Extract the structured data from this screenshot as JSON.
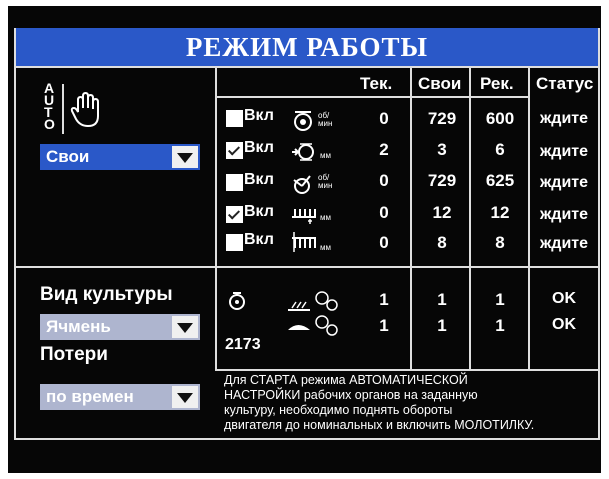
{
  "title": "РЕЖИМ РАБОТЫ",
  "mode": {
    "auto_label": "AUTO",
    "selected": "Свои"
  },
  "table": {
    "headers": [
      "Тек.",
      "Свои",
      "Рек.",
      "Статус"
    ],
    "rows": [
      {
        "toggle": "Вкл",
        "checked": false,
        "unit": "об/мин",
        "icon": "rotor-speed-icon",
        "tek": "0",
        "svoi": "729",
        "rek": "600",
        "status": "ждите"
      },
      {
        "toggle": "Вкл",
        "checked": true,
        "unit": "мм",
        "icon": "concave-gap-icon",
        "tek": "2",
        "svoi": "3",
        "rek": "6",
        "status": "ждите"
      },
      {
        "toggle": "Вкл",
        "checked": false,
        "unit": "об/мин",
        "icon": "fan-speed-icon",
        "tek": "0",
        "svoi": "729",
        "rek": "625",
        "status": "ждите"
      },
      {
        "toggle": "Вкл",
        "checked": true,
        "unit": "мм",
        "icon": "upper-sieve-icon",
        "tek": "0",
        "svoi": "12",
        "rek": "12",
        "status": "ждите"
      },
      {
        "toggle": "Вкл",
        "checked": false,
        "unit": "мм",
        "icon": "lower-sieve-icon",
        "tek": "0",
        "svoi": "8",
        "rek": "8",
        "status": "ждите"
      }
    ]
  },
  "crop": {
    "label": "Вид культуры",
    "selected": "Ячмень"
  },
  "losses": {
    "label": "Потери",
    "selected": "по времен"
  },
  "loss_sensors": {
    "code": "2173",
    "rows": [
      {
        "icon": "straw-walker-loss-icon",
        "tek": "1",
        "svoi": "1",
        "rek": "1",
        "status": "OK"
      },
      {
        "icon": "sieve-loss-icon",
        "tek": "1",
        "svoi": "1",
        "rek": "1",
        "status": "OK"
      }
    ]
  },
  "message": [
    "Для СТАРТА режима АВТОМАТИЧЕСКОЙ",
    "НАСТРОЙКИ рабочих органов на заданную",
    "культуру, необходимо поднять обороты",
    "двигателя до номинальных и включить МОЛОТИЛКУ."
  ],
  "colors": {
    "accent": "#2a58c8",
    "background": "#060606",
    "text": "#ffffff"
  }
}
